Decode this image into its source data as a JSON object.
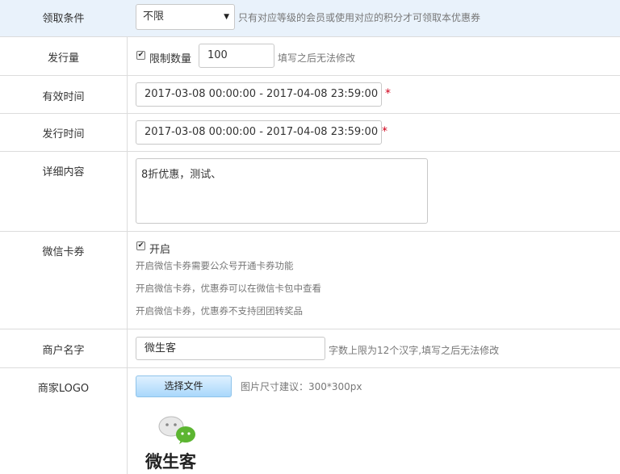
{
  "rows": {
    "claim_condition": {
      "label": "领取条件",
      "select_value": "不限",
      "hint": "只有对应等级的会员或使用对应的积分才可领取本优惠券"
    },
    "issue_quantity": {
      "label": "发行量",
      "checkbox_label": "限制数量",
      "checked": true,
      "value": "100",
      "hint": "填写之后无法修改"
    },
    "valid_time": {
      "label": "有效时间",
      "value": "2017-03-08 00:00:00 - 2017-04-08 23:59:00",
      "required_mark": "*"
    },
    "issue_time": {
      "label": "发行时间",
      "value": "2017-03-08 00:00:00 - 2017-04-08 23:59:00",
      "required_mark": "*"
    },
    "details": {
      "label": "详细内容",
      "value": "8折优惠，测试、"
    },
    "wechat_card": {
      "label": "微信卡券",
      "checkbox_label": "开启",
      "checked": true,
      "notes": [
        "开启微信卡券需要公众号开通卡券功能",
        "开启微信卡券，优惠券可以在微信卡包中查看",
        "开启微信卡券，优惠券不支持团团转奖品"
      ]
    },
    "merchant_name": {
      "label": "商户名字",
      "value": "微生客",
      "hint": "字数上限为12个汉字,填写之后无法修改"
    },
    "merchant_logo": {
      "label": "商家LOGO",
      "button_label": "选择文件",
      "hint": "图片尺寸建议：300*300px",
      "logo_text": "微生客"
    }
  },
  "colors": {
    "highlight_row": "#e9f2fb",
    "required": "#d0021b",
    "button_gradient_top": "#dff1ff",
    "button_gradient_bottom": "#a9d8fb",
    "logo_green": "#5cb531"
  },
  "icons": {
    "select_arrow": "chevron-down-icon",
    "checkbox": "checkmark-icon",
    "logo": "wechat-bubbles-icon"
  }
}
